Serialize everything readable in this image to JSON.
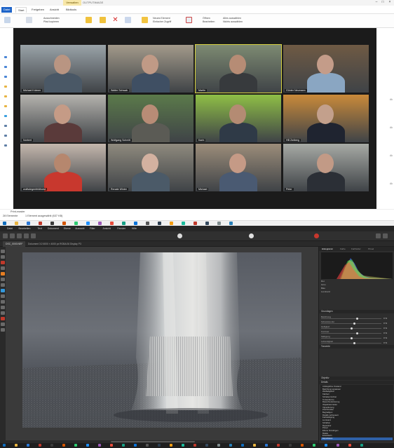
{
  "explorer": {
    "title": "OUTPUTIMAGE",
    "context_tab": "Verwalten",
    "tabs": [
      "Datei",
      "Start",
      "Freigeben",
      "Ansicht",
      "Bildtools"
    ],
    "ribbon": {
      "cut": "Ausschneiden",
      "copy_path": "Pfad kopieren",
      "new_item": "Neues Element",
      "easy_access": "Einfacher Zugriff",
      "open": "Öffnen",
      "edit": "Bearbeiten",
      "select_all": "Alles auswählen",
      "select_none": "Nichts auswählen"
    },
    "status_left": "28 Elemente",
    "status_mid": "1 Element ausgewählt (637 KB)",
    "status_bottom_left": "Print-master",
    "strip_texts": [
      "Ak",
      "Ak",
      "Ak",
      "Ak"
    ]
  },
  "zoom": {
    "participants": [
      {
        "name": "Michael Krämer",
        "bg": "#9aa3a8",
        "skin": "#b99582",
        "shirt": "#4a5866"
      },
      {
        "name": "Walter Schwab",
        "bg": "#a39a8b",
        "skin": "#c09a86",
        "shirt": "#3f4f63"
      },
      {
        "name": "Martin",
        "bg": "#7d8a72",
        "skin": "#b68c75",
        "shirt": "#373a3d"
      },
      {
        "name": "Günter Neumann",
        "bg": "#6f5a44",
        "skin": "#c49c89",
        "shirt": "#8aa6c2"
      },
      {
        "name": "Norbert",
        "bg": "#b5b3ae",
        "skin": "#c59b86",
        "shirt": "#5a3a3a"
      },
      {
        "name": "Wolfgang Schmitt",
        "bg": "#5b7a4a",
        "skin": "#b88c76",
        "shirt": "#5b5b55"
      },
      {
        "name": "Karin",
        "bg": "#8fbf46",
        "skin": "#b48b73",
        "shirt": "#2f3a47"
      },
      {
        "name": "HB Zwiberg",
        "bg": "#c98a3a",
        "skin": "#c3a08c",
        "shirt": "#1f2430"
      },
      {
        "name": "wolfsdegenfeldhorst",
        "bg": "#c4b7ad",
        "skin": "#b6876e",
        "shirt": "#c8382e"
      },
      {
        "name": "Renate Winter",
        "bg": "#8f8a7e",
        "skin": "#d3b1a0",
        "shirt": "#4b5a68"
      },
      {
        "name": "Michael",
        "bg": "#9c8d7a",
        "skin": "#c59a86",
        "shirt": "#4a5a72"
      },
      {
        "name": "Peter",
        "bg": "#a7aaa5",
        "skin": "#c29a86",
        "shirt": "#2b2f36"
      }
    ]
  },
  "affinity": {
    "menus": [
      "Datei",
      "Bearbeiten",
      "Text",
      "Dokument",
      "Ebene",
      "Auswahl",
      "Filter",
      "Ansicht",
      "Fenster",
      "Hilfe"
    ],
    "doc_tab": "DSC_0000.NEF",
    "ctx_info": "Dokument   3:2   6000 × 4000 px   RGBA/16   Display P3",
    "panel_tabs": [
      "Histogramm",
      "Farbe",
      "Farbfelder",
      "Pinsel"
    ],
    "histo_meta": [
      "Rot",
      "Grün",
      "Blau",
      "Luminanz"
    ],
    "sections": [
      "Grundlagen",
      "Tonwerte",
      "Objektiv",
      "Details"
    ],
    "slider_labels": [
      "Belichtung",
      "Schwarzpunkt",
      "Helligkeit",
      "Kontrast",
      "Sättigung",
      "Lebendigkeit"
    ],
    "slider_values": [
      "0 %",
      "0 %",
      "0 %",
      "0 %",
      "0 %",
      "0 %"
    ],
    "slider_levels": [
      0.6,
      0.55,
      0.5,
      0.6,
      0.5,
      0.55
    ],
    "history": [
      "Anfänglicher Zustand",
      "Belichtung anpassen",
      "Weißabgleich",
      "Klarheit",
      "Schatten/Lichter",
      "Tonwertkurve",
      "Rauschreduzierung",
      "Objektivkorrektur",
      "Vignettierung",
      "Zuschneiden",
      "Begradigen",
      "Details verbessern",
      "Farbsättigung",
      "Luminanz",
      "Schärfen",
      "Reparatur",
      "Pinsel",
      "Ebene hinzufügen",
      "Maske",
      "Entwickeln",
      "Exportieren"
    ],
    "history_selected_index": 20
  }
}
